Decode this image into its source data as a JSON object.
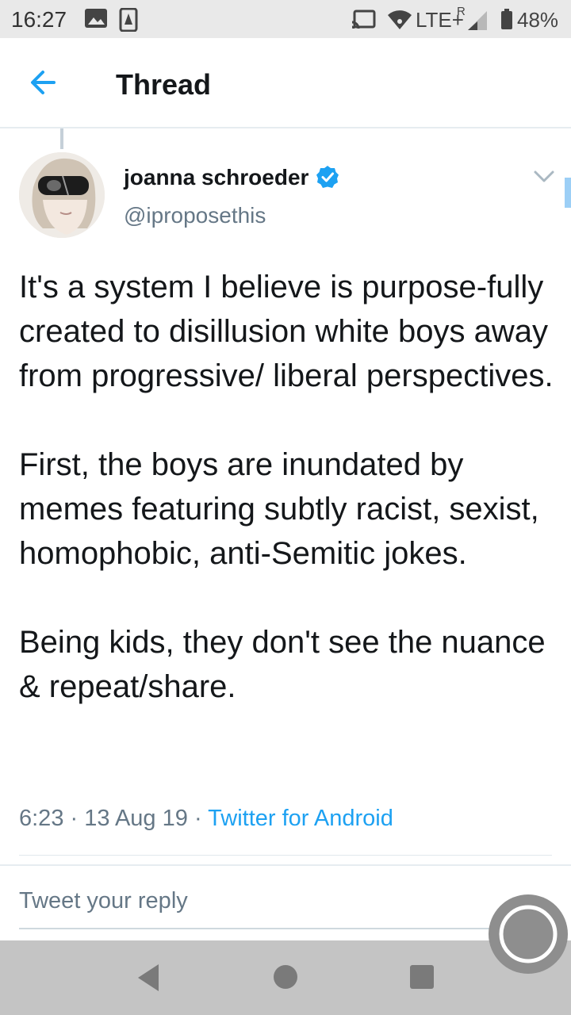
{
  "status_bar": {
    "time": "16:27",
    "network": "LTE+",
    "roaming": "R",
    "battery": "48%"
  },
  "header": {
    "title": "Thread"
  },
  "tweet": {
    "author_name": "joanna schroeder",
    "author_handle": "@iproposethis",
    "paragraphs": [
      "It's a system I believe is purpose-fully created to disillusion white boys away from progressive/ liberal perspectives.",
      "First, the boys are inundated by memes featuring subtly racist, sexist, homophobic, anti-Semitic jokes.",
      "Being kids, they don't see the nuance & repeat/share."
    ],
    "time": "6:23",
    "date": "13 Aug 19",
    "source": "Twitter for Android"
  },
  "reply": {
    "placeholder": "Tweet your reply"
  },
  "colors": {
    "accent": "#1da1f2",
    "secondary_text": "#657786",
    "primary_text": "#14171a"
  }
}
